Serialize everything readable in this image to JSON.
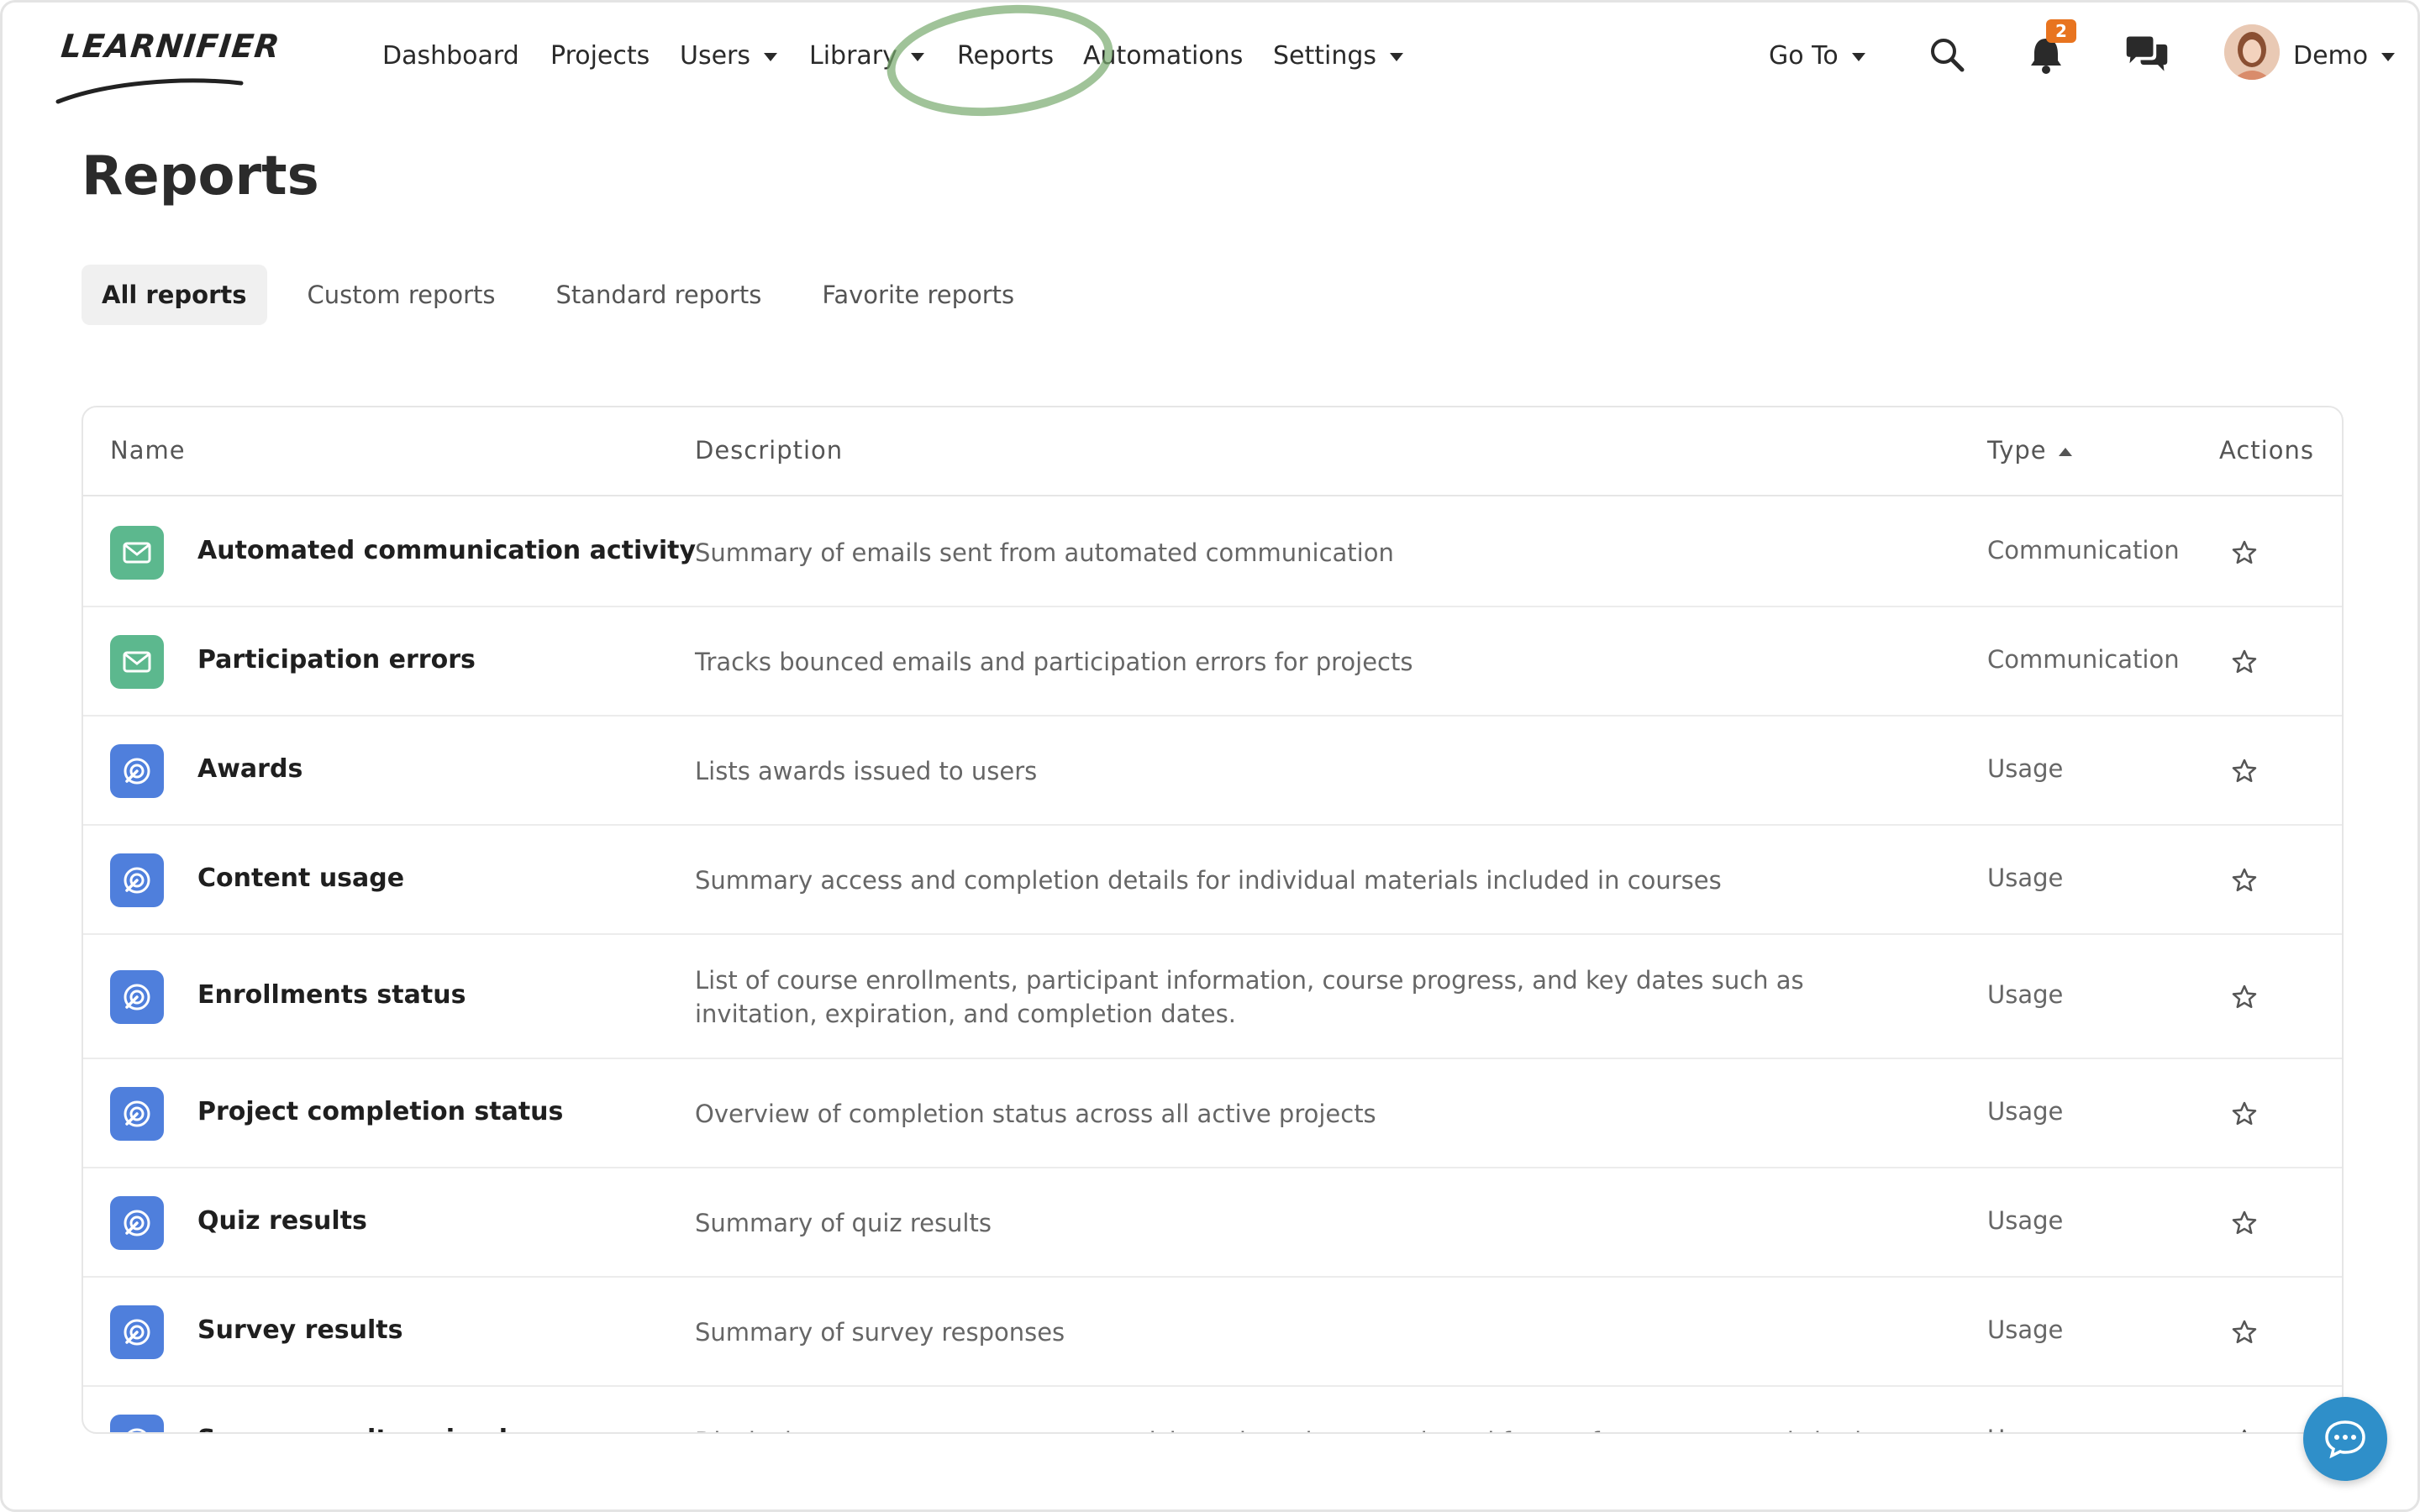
{
  "brand": {
    "logo_text": "LEARNIFIER"
  },
  "nav": {
    "items": [
      {
        "label": "Dashboard",
        "has_caret": false
      },
      {
        "label": "Projects",
        "has_caret": false
      },
      {
        "label": "Users",
        "has_caret": true
      },
      {
        "label": "Library",
        "has_caret": true
      },
      {
        "label": "Reports",
        "has_caret": false
      },
      {
        "label": "Automations",
        "has_caret": false
      },
      {
        "label": "Settings",
        "has_caret": true
      }
    ],
    "goto_label": "Go To",
    "notification_count": "2",
    "user_name": "Demo",
    "icons": {
      "search": "search-icon",
      "notifications": "bell-icon",
      "messages": "chat-bubbles-icon"
    }
  },
  "page": {
    "title": "Reports"
  },
  "tabs": [
    {
      "label": "All reports",
      "active": true
    },
    {
      "label": "Custom reports",
      "active": false
    },
    {
      "label": "Standard reports",
      "active": false
    },
    {
      "label": "Favorite reports",
      "active": false
    }
  ],
  "table": {
    "columns": {
      "name": "Name",
      "description": "Description",
      "type": "Type",
      "actions": "Actions"
    },
    "sorted_by": "Type",
    "sort_direction": "ascending",
    "rows": [
      {
        "name": "Automated communication activity",
        "description": "Summary of emails sent from automated communication",
        "type": "Communication",
        "icon": "envelope-icon"
      },
      {
        "name": "Participation errors",
        "description": "Tracks bounced emails and participation errors for projects",
        "type": "Communication",
        "icon": "envelope-icon"
      },
      {
        "name": "Awards",
        "description": "Lists awards issued to users",
        "type": "Usage",
        "icon": "usage-icon"
      },
      {
        "name": "Content usage",
        "description": "Summary access and completion details for individual materials included in courses",
        "type": "Usage",
        "icon": "usage-icon"
      },
      {
        "name": "Enrollments status",
        "description": "List of course enrollments, participant information, course progress, and key dates such as invitation, expiration, and completion dates.",
        "type": "Usage",
        "icon": "usage-icon"
      },
      {
        "name": "Project completion status",
        "description": "Overview of completion status across all active projects",
        "type": "Usage",
        "icon": "usage-icon"
      },
      {
        "name": "Quiz results",
        "description": "Summary of quiz results",
        "type": "Usage",
        "icon": "usage-icon"
      },
      {
        "name": "Survey results",
        "description": "Summary of survey responses",
        "type": "Usage",
        "icon": "usage-icon"
      },
      {
        "name": "Survey results - simple",
        "description": "Displaying survey responses per participant in a clear, row-based format for easy use and sharing",
        "type": "Usage",
        "icon": "usage-icon"
      }
    ]
  },
  "colors": {
    "communication": "#5cb88e",
    "usage": "#4f7fdc",
    "badge": "#e8741f",
    "chat_fab": "#2f8fc9"
  }
}
